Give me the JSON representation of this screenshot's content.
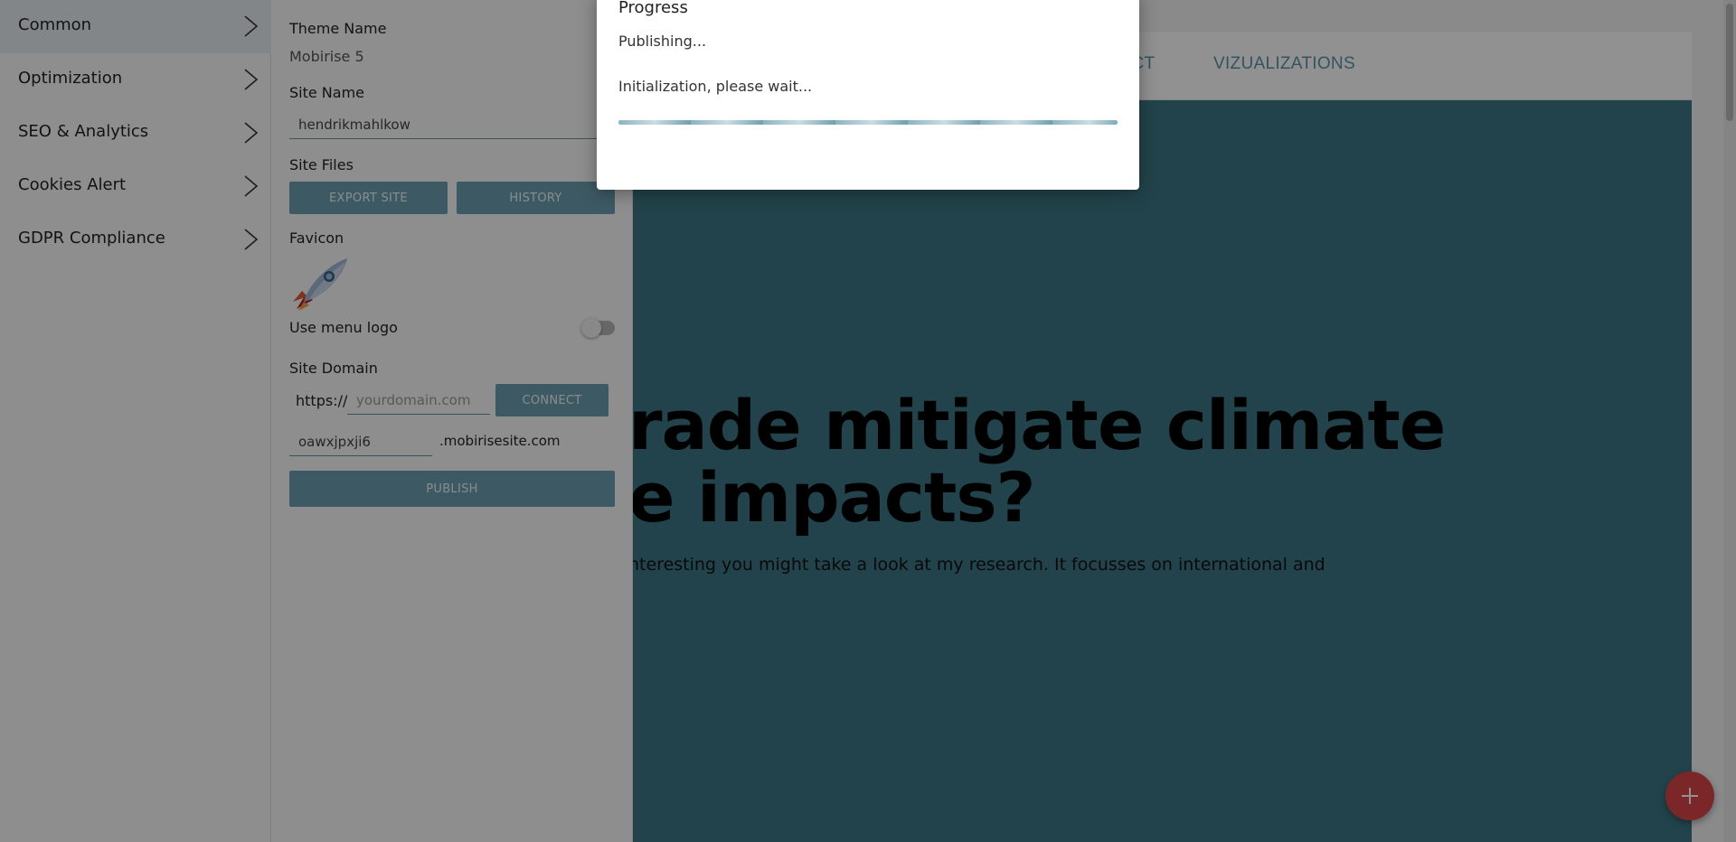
{
  "site_preview": {
    "nav": {
      "contact_label": "TACT",
      "vizualizations_label": "VIZUALIZATIONS"
    },
    "hero": {
      "title_line1": "rade mitigate climate",
      "title_line2": "e impacts?",
      "text_line1": "nteresting you might take a look at my research. It focusses on international and",
      "text_line2": "."
    }
  },
  "sidebar": {
    "items": [
      {
        "label": "Common",
        "active": true
      },
      {
        "label": "Optimization",
        "active": false
      },
      {
        "label": "SEO & Analytics",
        "active": false
      },
      {
        "label": "Cookies Alert",
        "active": false
      },
      {
        "label": "GDPR Compliance",
        "active": false
      }
    ]
  },
  "panel": {
    "theme_name_label": "Theme Name",
    "theme_name_value": "Mobirise 5",
    "site_name_label": "Site Name",
    "site_name_value": "hendrikmahlkow",
    "site_files_label": "Site Files",
    "export_button": "EXPORT SITE",
    "history_button": "HISTORY",
    "favicon_label": "Favicon",
    "use_menu_logo_label": "Use menu logo",
    "use_menu_logo_on": false,
    "site_domain_label": "Site Domain",
    "protocol": "https://",
    "domain_placeholder": "yourdomain.com",
    "connect_button": "CONNECT",
    "subdomain_value": "oawxjpxji6",
    "subdomain_suffix": ".mobirisesite.com",
    "publish_button": "PUBLISH"
  },
  "modal": {
    "title": "Progress",
    "status": "Publishing...",
    "detail": "Initialization, please wait...",
    "progress": 1.0
  },
  "colors": {
    "accent": "#6b9fb0",
    "hero_bg": "#3c7685",
    "fab": "#d9464b"
  },
  "icons": {
    "sidebar_chevron": "chevron-right-icon",
    "favicon": "rocket-icon",
    "fab": "plus-icon"
  }
}
